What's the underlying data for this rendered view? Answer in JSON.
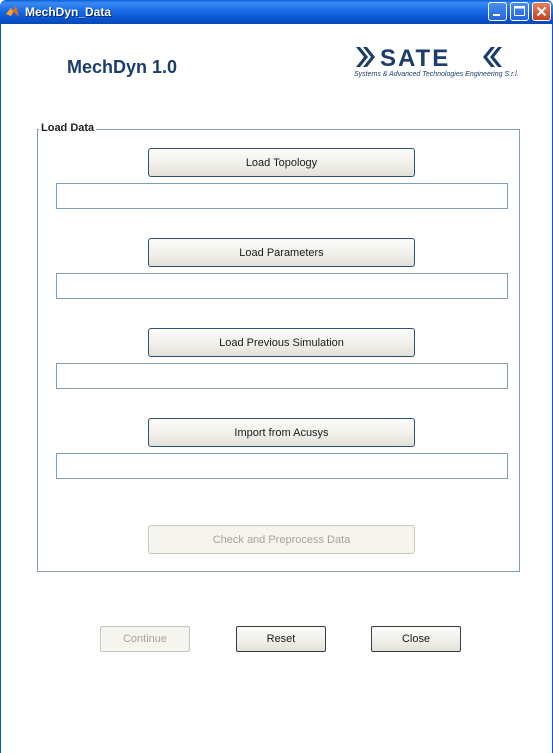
{
  "window": {
    "title": "MechDyn_Data",
    "titlebar_color": "#0a56d0",
    "icons": [
      "matlab-icon",
      "minimize-icon",
      "maximize-icon",
      "close-icon"
    ]
  },
  "header": {
    "app_title": "MechDyn 1.0",
    "logo_text": "SATE",
    "logo_subtitle": "Systems & Advanced Technologies Engineering S.r.l."
  },
  "load_data": {
    "group_label": "Load Data",
    "load_topology": {
      "label": "Load Topology",
      "value": ""
    },
    "load_parameters": {
      "label": "Load Parameters",
      "value": ""
    },
    "load_previous": {
      "label": "Load Previous Simulation",
      "value": ""
    },
    "import_acusys": {
      "label": "Import from Acusys",
      "value": ""
    },
    "check_preprocess": {
      "label": "Check and Preprocess Data",
      "enabled": false
    }
  },
  "footer": {
    "continue": {
      "label": "Continue",
      "enabled": false
    },
    "reset": {
      "label": "Reset",
      "enabled": true
    },
    "close": {
      "label": "Close",
      "enabled": true
    }
  }
}
